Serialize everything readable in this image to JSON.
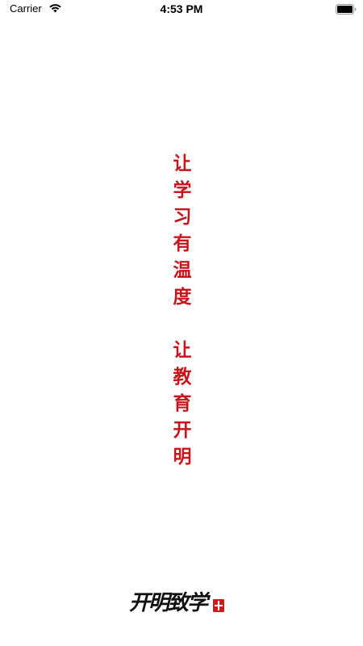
{
  "status_bar": {
    "carrier": "Carrier",
    "time": "4:53 PM"
  },
  "slogan": {
    "part1": [
      "让",
      "学",
      "习",
      "有",
      "温",
      "度"
    ],
    "part2": [
      "让",
      "教",
      "育",
      "开",
      "明"
    ],
    "color": "#c6161c"
  },
  "brand": {
    "logo_text": "开明致学"
  }
}
